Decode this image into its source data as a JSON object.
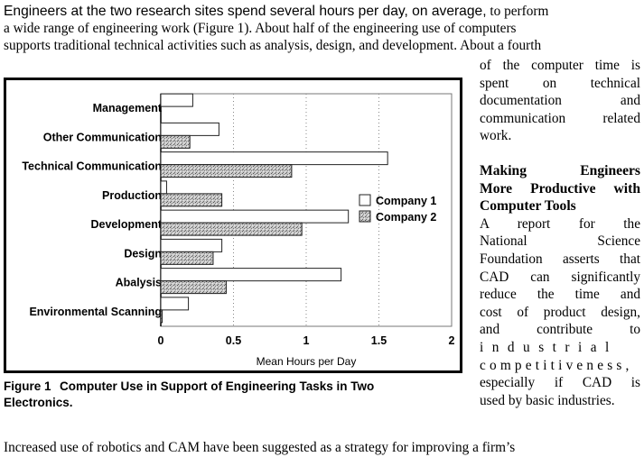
{
  "body_text": {
    "line1_sans": "Engineers at the two research sites spend several hours per day, on average,",
    "line1_serif": " to perform",
    "line2": "a wide range of engineering work (Figure 1).  About half of the engineering use of computers",
    "line3": "supports traditional technical activities such as analysis, design, and development.  About a fourth",
    "side_para1": [
      "of the computer time is",
      "spent on technical",
      "documentation and",
      "communication related",
      "work."
    ],
    "side_heading": [
      "Making Engineers",
      "More Productive with",
      "Computer Tools"
    ],
    "side_para2": [
      "A report for the",
      "National Science",
      "Foundation asserts that",
      "CAD can significantly",
      "reduce the time and",
      "cost of product design,",
      "and contribute to",
      "industrial",
      "competitiveness,",
      "especially if CAD is",
      "used by basic industries."
    ],
    "last_line": "Increased use of robotics and CAM have been suggested as a strategy for improving a firm’s"
  },
  "figure": {
    "number": "Figure 1",
    "caption_line1": "Computer Use in Support of Engineering Tasks in Two",
    "caption_line2": "Electronics."
  },
  "chart_data": {
    "type": "bar",
    "orientation": "horizontal",
    "title": "",
    "xlabel": "Mean Hours per Day",
    "ylabel": "",
    "xlim": [
      0,
      2
    ],
    "xticks": [
      "0",
      "0.5",
      "1",
      "1.5",
      "2"
    ],
    "xtick_values": [
      0,
      0.5,
      1,
      1.5,
      2
    ],
    "grid": "vertical-dotted",
    "legend_position": "right-middle",
    "categories": [
      "Management",
      "Other Communication",
      "Technical Communication",
      "Production",
      "Development",
      "Design",
      "Abalysis",
      "Environmental Scanning"
    ],
    "series": [
      {
        "name": "Company 1",
        "fill": "#ffffff",
        "values": [
          0.22,
          0.4,
          1.56,
          0.04,
          1.29,
          0.42,
          1.24,
          0.19
        ]
      },
      {
        "name": "Company 2",
        "fill": "#b8b8b8",
        "values": [
          0.0,
          0.2,
          0.9,
          0.42,
          0.97,
          0.36,
          0.45,
          0.01
        ]
      }
    ]
  }
}
